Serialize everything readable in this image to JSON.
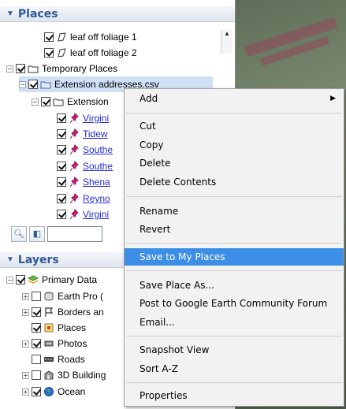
{
  "places": {
    "header": "Places",
    "items": [
      {
        "label": "leaf off foliage 1",
        "checked": true
      },
      {
        "label": "leaf off foliage 2",
        "checked": true
      },
      {
        "label": "Temporary Places",
        "checked": true
      },
      {
        "label": "Extension addresses.csv",
        "checked": true
      },
      {
        "label": "Extension",
        "checked": true
      },
      {
        "label": "Virgini",
        "checked": true
      },
      {
        "label": "Tidew",
        "checked": true
      },
      {
        "label": "Southe",
        "checked": true
      },
      {
        "label": "Southe",
        "checked": true
      },
      {
        "label": "Shena",
        "checked": true
      },
      {
        "label": "Reyno",
        "checked": true
      },
      {
        "label": "Virgini",
        "checked": true
      }
    ]
  },
  "layers": {
    "header": "Layers",
    "items": [
      {
        "label": "Primary Data",
        "checked": true
      },
      {
        "label": "Earth Pro (",
        "checked": false
      },
      {
        "label": "Borders an",
        "checked": true
      },
      {
        "label": "Places",
        "checked": true
      },
      {
        "label": "Photos",
        "checked": true
      },
      {
        "label": "Roads",
        "checked": false
      },
      {
        "label": "3D Building",
        "checked": false
      },
      {
        "label": "Ocean",
        "checked": true
      }
    ]
  },
  "menu": {
    "items": [
      {
        "label": "Add",
        "has_submenu": true
      },
      {
        "label": "Cut"
      },
      {
        "label": "Copy"
      },
      {
        "label": "Delete"
      },
      {
        "label": "Delete Contents"
      },
      {
        "label": "Rename"
      },
      {
        "label": "Revert"
      },
      {
        "label": "Save to My Places",
        "highlighted": true
      },
      {
        "label": "Save Place As..."
      },
      {
        "label": "Post to Google Earth Community Forum"
      },
      {
        "label": "Email..."
      },
      {
        "label": "Snapshot View"
      },
      {
        "label": "Sort A-Z"
      },
      {
        "label": "Properties"
      }
    ]
  },
  "icons": {
    "header_toggle": "expand-triangle-icon",
    "search": "search-icon",
    "panel_toggle": "panel-toggle-icon",
    "submenu": "submenu-arrow-icon",
    "pushpin": "pushpin-icon"
  },
  "colors": {
    "header_text": "#2e5a9a",
    "highlight": "#3d8ee6",
    "selection": "#cfe0f7",
    "link": "#2a2ad4",
    "pushpin": "#c8207a"
  }
}
